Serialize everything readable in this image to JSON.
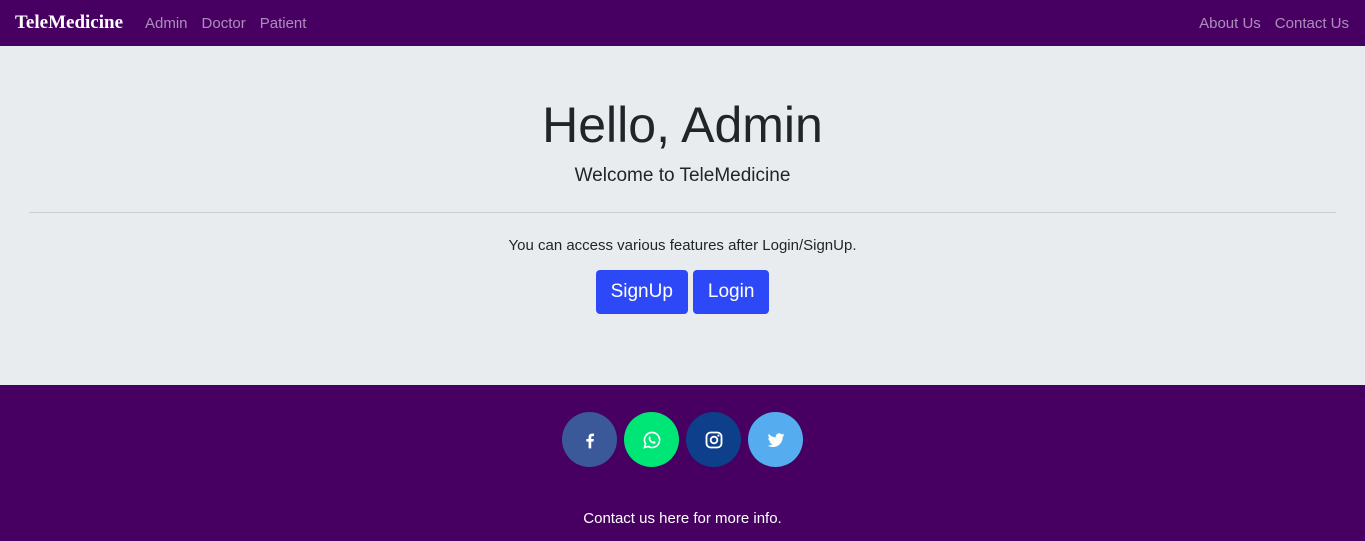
{
  "navbar": {
    "brand": "TeleMedicine",
    "left_links": [
      "Admin",
      "Doctor",
      "Patient"
    ],
    "right_links": [
      "About Us",
      "Contact Us"
    ]
  },
  "hero": {
    "title": "Hello, Admin",
    "subtitle": "Welcome to TeleMedicine",
    "text": "You can access various features after Login/SignUp.",
    "signup_label": "SignUp",
    "login_label": "Login"
  },
  "footer": {
    "socials": [
      {
        "icon": "facebook-icon",
        "color": "#3b5998"
      },
      {
        "icon": "whatsapp-icon",
        "color": "#00e676"
      },
      {
        "icon": "instagram-icon",
        "color": "#0e3f8a"
      },
      {
        "icon": "twitter-icon",
        "color": "#55acee"
      }
    ],
    "text": "Contact us here for more info."
  },
  "colors": {
    "navbar_bg": "#470062",
    "button_bg": "#2d49f7",
    "page_bg": "#e9ecef"
  }
}
